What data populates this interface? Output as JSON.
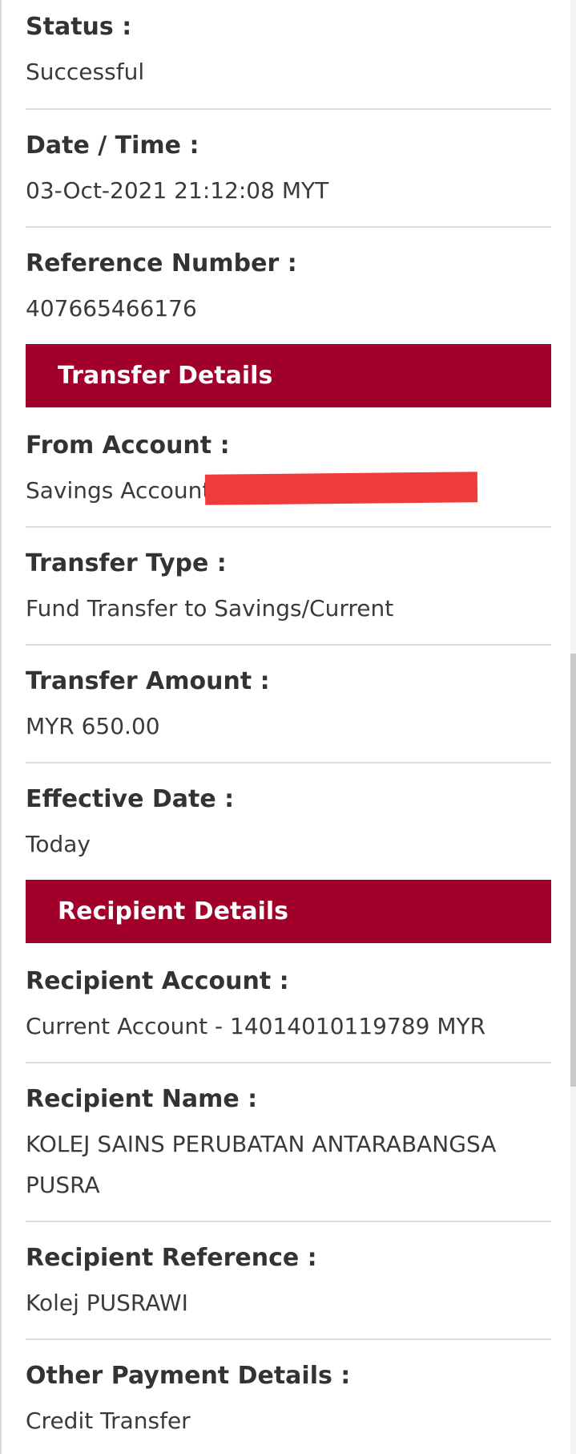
{
  "fields_top": [
    {
      "label": "Status :",
      "value": "Successful"
    },
    {
      "label": "Date / Time :",
      "value": "03-Oct-2021 21:12:08 MYT"
    },
    {
      "label": "Reference Number :",
      "value": "407665466176"
    }
  ],
  "transfer_section": {
    "title": "Transfer Details",
    "from_account": {
      "label": "From Account :",
      "value": "Savings Account - 1"
    },
    "transfer_type": {
      "label": "Transfer Type :",
      "value": "Fund Transfer to Savings/Current"
    },
    "transfer_amount": {
      "label": "Transfer Amount :",
      "value": "MYR 650.00"
    },
    "effective_date": {
      "label": "Effective Date :",
      "value": "Today"
    }
  },
  "recipient_section": {
    "title": "Recipient Details",
    "recipient_account": {
      "label": "Recipient Account :",
      "value": "Current Account - 14014010119789 MYR"
    },
    "recipient_name": {
      "label": "Recipient Name :",
      "value_line1": "KOLEJ SAINS PERUBATAN ANTARABANGSA",
      "value_line2": "PUSRA"
    },
    "recipient_reference": {
      "label": "Recipient Reference :",
      "value": "Kolej PUSRAWI"
    },
    "other_payment": {
      "label": "Other Payment Details :",
      "value": "Credit Transfer"
    }
  },
  "colors": {
    "section_header_bg": "#a0002a",
    "redaction": "#ef3b3b",
    "divider": "#dcdcdc"
  }
}
